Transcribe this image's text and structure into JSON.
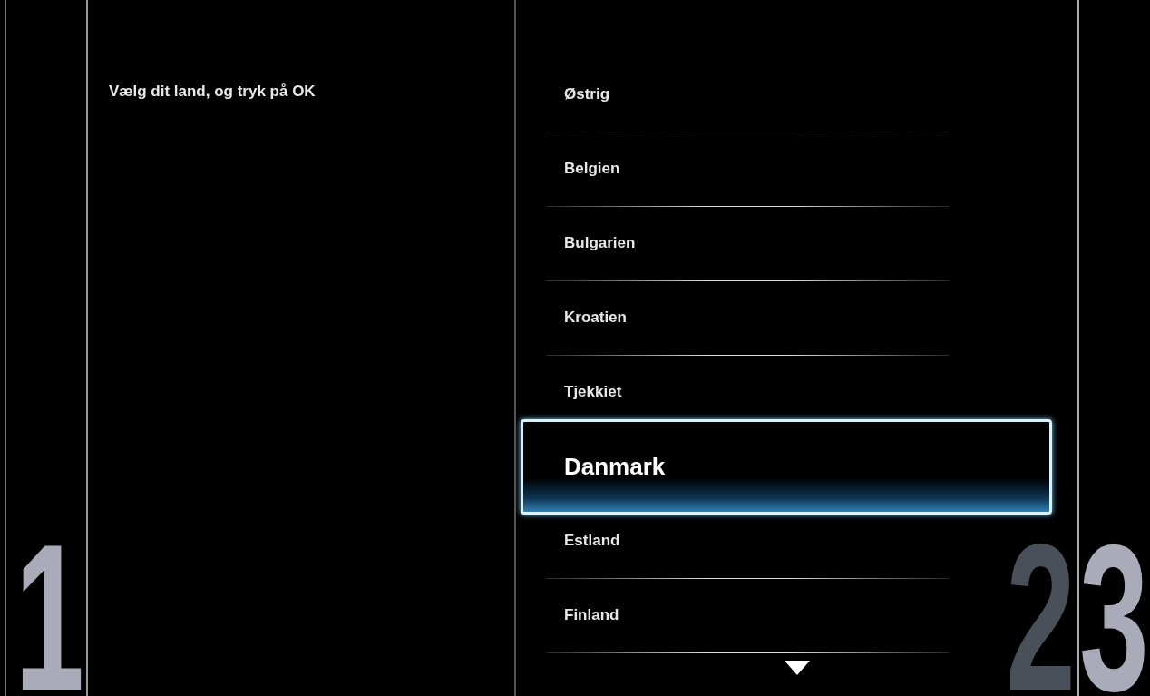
{
  "prompt": "Vælg dit land, og tryk på OK",
  "steps": [
    {
      "label": "1",
      "current": false
    },
    {
      "label": "2",
      "current": true
    },
    {
      "label": "3",
      "current": false
    }
  ],
  "countries": [
    {
      "label": "Østrig",
      "selected": false
    },
    {
      "label": "Belgien",
      "selected": false
    },
    {
      "label": "Bulgarien",
      "selected": false
    },
    {
      "label": "Kroatien",
      "selected": false
    },
    {
      "label": "Tjekkiet",
      "selected": false
    },
    {
      "label": "Danmark",
      "selected": true
    },
    {
      "label": "Estland",
      "selected": false
    },
    {
      "label": "Finland",
      "selected": false
    }
  ],
  "more_below": true
}
